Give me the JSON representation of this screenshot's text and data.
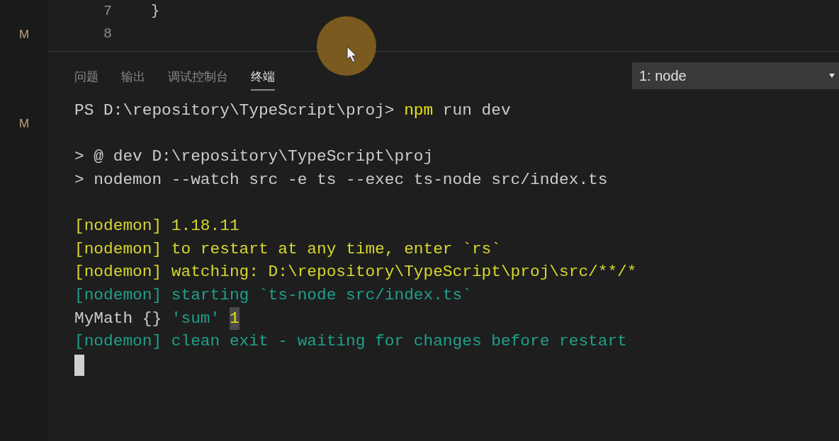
{
  "gutter": {
    "badges": [
      "M",
      "M"
    ]
  },
  "editor": {
    "lines": [
      {
        "number": "7",
        "code": "}"
      },
      {
        "number": "8"
      }
    ]
  },
  "panel": {
    "tabs": [
      {
        "label": "问题",
        "selected": false
      },
      {
        "label": "输出",
        "selected": false
      },
      {
        "label": "调试控制台",
        "selected": false
      },
      {
        "label": "终端",
        "selected": true
      }
    ],
    "terminal_select": {
      "value": "1: node"
    }
  },
  "terminal": {
    "lines": [
      {
        "kind": "text",
        "segments": [
          {
            "kind": "plain",
            "text": "PS D:\\repository\\TypeScript\\proj> "
          },
          {
            "kind": "command",
            "text": "npm"
          },
          {
            "kind": "plain",
            "text": " run dev"
          }
        ]
      },
      {
        "kind": "blank"
      },
      {
        "kind": "text",
        "segments": [
          {
            "kind": "plain",
            "text": "> @ dev D:\\repository\\TypeScript\\proj"
          }
        ]
      },
      {
        "kind": "text",
        "segments": [
          {
            "kind": "plain",
            "text": "> nodemon --watch src -e ts --exec ts-node src/index.ts"
          }
        ]
      },
      {
        "kind": "blank"
      },
      {
        "kind": "text",
        "segments": [
          {
            "kind": "yellow",
            "text": "[nodemon] 1.18.11"
          }
        ]
      },
      {
        "kind": "text",
        "segments": [
          {
            "kind": "yellow",
            "text": "[nodemon] to restart at any time, enter `rs`"
          }
        ]
      },
      {
        "kind": "text",
        "segments": [
          {
            "kind": "yellow",
            "text": "[nodemon] watching: D:\\repository\\TypeScript\\proj\\src/**/*"
          }
        ]
      },
      {
        "kind": "text",
        "segments": [
          {
            "kind": "green",
            "text": "[nodemon] starting `ts-node src/index.ts`"
          }
        ]
      },
      {
        "kind": "text",
        "segments": [
          {
            "kind": "plain",
            "text": "MyMath {}"
          }
        ],
        "tail": [
          {
            "kind": "string",
            "text": "'sum'"
          },
          {
            "kind": "highlight",
            "text": "1"
          }
        ]
      },
      {
        "kind": "text",
        "segments": [
          {
            "kind": "green",
            "text": "[nodemon] clean exit - waiting for changes before restart"
          }
        ]
      }
    ],
    "cursor": true
  }
}
